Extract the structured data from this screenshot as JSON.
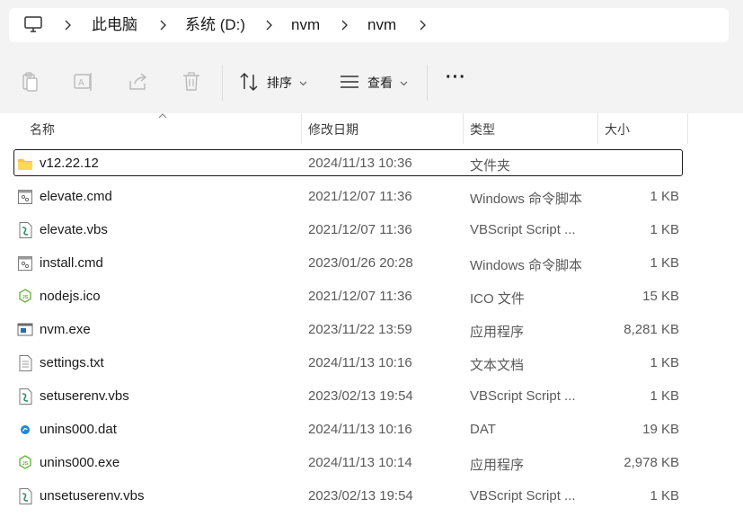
{
  "breadcrumb": {
    "items": [
      {
        "label": "此电脑"
      },
      {
        "label": "系统 (D:)"
      },
      {
        "label": "nvm"
      },
      {
        "label": "nvm"
      }
    ]
  },
  "toolbar": {
    "sort_label": "排序",
    "view_label": "查看",
    "more_label": "···"
  },
  "columns": {
    "name": "名称",
    "date": "修改日期",
    "type": "类型",
    "size": "大小"
  },
  "files": [
    {
      "name": "v12.22.12",
      "date": "2024/11/13 10:36",
      "type": "文件夹",
      "size": "",
      "icon": "folder-icon",
      "selected": true
    },
    {
      "name": "elevate.cmd",
      "date": "2021/12/07 11:36",
      "type": "Windows 命令脚本",
      "size": "1 KB",
      "icon": "cmd-file-icon"
    },
    {
      "name": "elevate.vbs",
      "date": "2021/12/07 11:36",
      "type": "VBScript Script ...",
      "size": "1 KB",
      "icon": "vbs-file-icon"
    },
    {
      "name": "install.cmd",
      "date": "2023/01/26 20:28",
      "type": "Windows 命令脚本",
      "size": "1 KB",
      "icon": "cmd-file-icon"
    },
    {
      "name": "nodejs.ico",
      "date": "2021/12/07 11:36",
      "type": "ICO 文件",
      "size": "15 KB",
      "icon": "nodejs-icon"
    },
    {
      "name": "nvm.exe",
      "date": "2023/11/22 13:59",
      "type": "应用程序",
      "size": "8,281 KB",
      "icon": "exe-file-icon"
    },
    {
      "name": "settings.txt",
      "date": "2024/11/13 10:16",
      "type": "文本文档",
      "size": "1 KB",
      "icon": "txt-file-icon"
    },
    {
      "name": "setuserenv.vbs",
      "date": "2023/02/13 19:54",
      "type": "VBScript Script ...",
      "size": "1 KB",
      "icon": "vbs-file-icon"
    },
    {
      "name": "unins000.dat",
      "date": "2024/11/13 10:16",
      "type": "DAT",
      "size": "19 KB",
      "icon": "dat-file-icon"
    },
    {
      "name": "unins000.exe",
      "date": "2024/11/13 10:14",
      "type": "应用程序",
      "size": "2,978 KB",
      "icon": "nodejs-icon"
    },
    {
      "name": "unsetuserenv.vbs",
      "date": "2023/02/13 19:54",
      "type": "VBScript Script ...",
      "size": "1 KB",
      "icon": "vbs-file-icon"
    }
  ]
}
